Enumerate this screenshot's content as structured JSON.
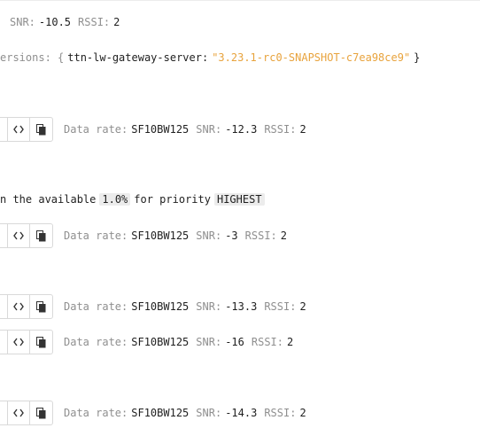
{
  "top_row": {
    "snr_label": "SNR:",
    "snr_value": "-10.5",
    "rssi_label": "RSSI:",
    "rssi_value": "2"
  },
  "versions_row": {
    "label": "ersions: {",
    "key": "ttn-lw-gateway-server:",
    "value": "\"3.23.1-rc0-SNAPSHOT-c7ea98ce9\"",
    "close": "}"
  },
  "priority_row": {
    "prefix": "n the available",
    "percent": "1.0%",
    "middle": "for priority",
    "priority": "HIGHEST"
  },
  "event_rows": [
    {
      "data_rate_label": "Data rate:",
      "data_rate": "SF10BW125",
      "snr_label": "SNR:",
      "snr": "-12.3",
      "rssi_label": "RSSI:",
      "rssi": "2"
    },
    {
      "data_rate_label": "Data rate:",
      "data_rate": "SF10BW125",
      "snr_label": "SNR:",
      "snr": "-3",
      "rssi_label": "RSSI:",
      "rssi": "2"
    },
    {
      "data_rate_label": "Data rate:",
      "data_rate": "SF10BW125",
      "snr_label": "SNR:",
      "snr": "-13.3",
      "rssi_label": "RSSI:",
      "rssi": "2"
    },
    {
      "data_rate_label": "Data rate:",
      "data_rate": "SF10BW125",
      "snr_label": "SNR:",
      "snr": "-16",
      "rssi_label": "RSSI:",
      "rssi": "2"
    },
    {
      "data_rate_label": "Data rate:",
      "data_rate": "SF10BW125",
      "snr_label": "SNR:",
      "snr": "-14.3",
      "rssi_label": "RSSI:",
      "rssi": "2"
    }
  ],
  "icons": {
    "code": "code-icon",
    "copy": "copy-icon"
  },
  "colors": {
    "label": "#8f8f8f",
    "value": "#1f1f1f",
    "string": "#e8a33d",
    "highlight_bg": "#ececec",
    "border": "#d9d9d9"
  }
}
